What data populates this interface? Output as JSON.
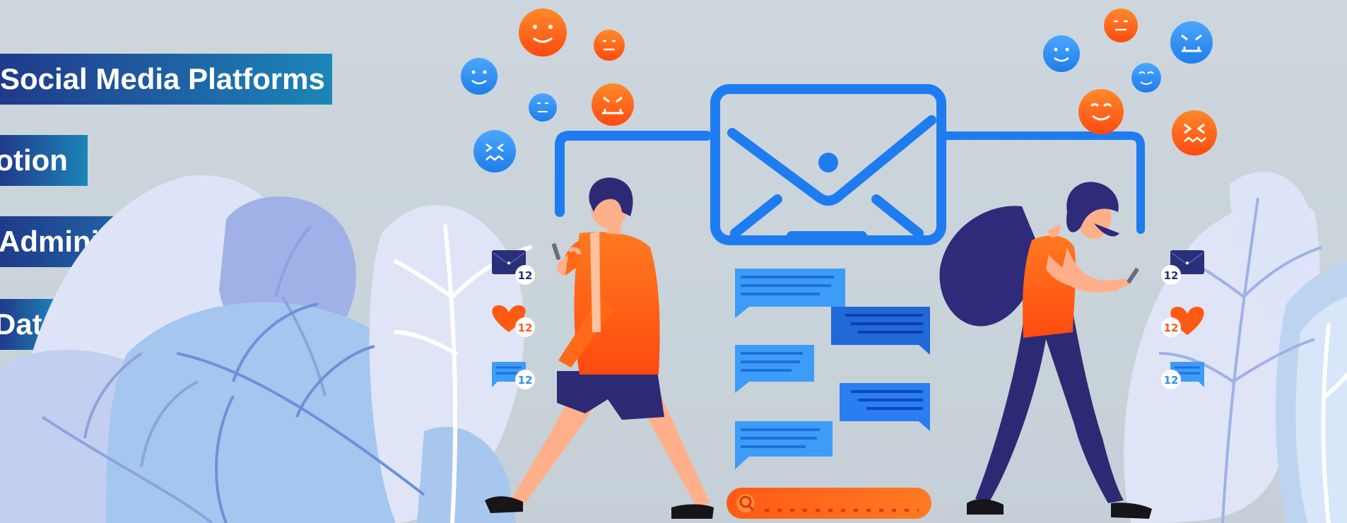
{
  "labels": [
    "Social Media Platforms",
    "motion",
    "Administration",
    "Data"
  ],
  "badge_count": "12",
  "colors": {
    "label_bg_start": "#1f3a8a",
    "label_bg_end": "#1b86b8",
    "emoji_orange": "#ff6a1a",
    "emoji_blue": "#2f8ff0",
    "envelope_blue": "#1e7cf0",
    "chat_blue": "#2f8ff0",
    "search_orange": "#ff5a14",
    "leaf_light": "#dfe6f7",
    "leaf_mid": "#9fb1e6"
  },
  "icons": [
    "happy-face-icon",
    "neutral-face-icon",
    "angry-face-icon",
    "envelope-icon",
    "heart-icon",
    "chat-icon",
    "search-icon"
  ]
}
